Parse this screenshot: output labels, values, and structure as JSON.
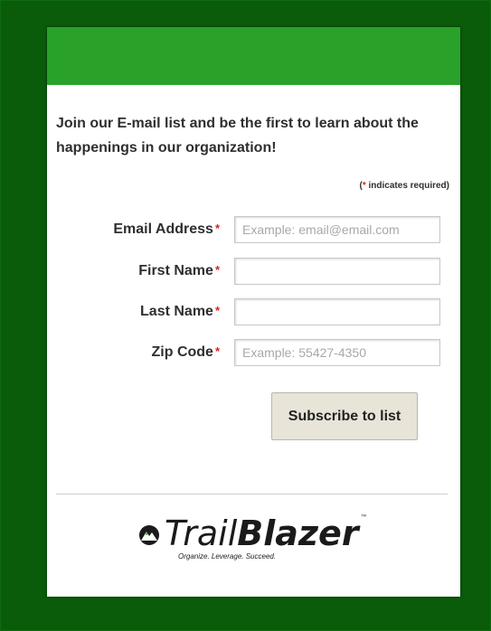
{
  "intro": "Join our E-mail list and be the first to learn about the happenings in our organization!",
  "required_note": {
    "star": "*",
    "text": " indicates required)",
    "open": "("
  },
  "fields": [
    {
      "label": "Email Address",
      "star": "*",
      "placeholder": "Example: email@email.com",
      "value": ""
    },
    {
      "label": "First Name",
      "star": "*",
      "placeholder": "",
      "value": ""
    },
    {
      "label": "Last Name",
      "star": "*",
      "placeholder": "",
      "value": ""
    },
    {
      "label": "Zip Code",
      "star": "*",
      "placeholder": "Example: 55427-4350",
      "value": ""
    }
  ],
  "submit_label": "Subscribe to list",
  "logo": {
    "light": "Trail",
    "bold": "Blazer",
    "tm": "™",
    "tagline": "Organize. Leverage. Succeed."
  },
  "colors": {
    "outer_background": "#0a5c0a",
    "banner": "#2aa22a",
    "required_star": "#dd2222",
    "button_background": "#e8e4d8"
  },
  "icons": {
    "logo_mark": "mountain-icon"
  }
}
